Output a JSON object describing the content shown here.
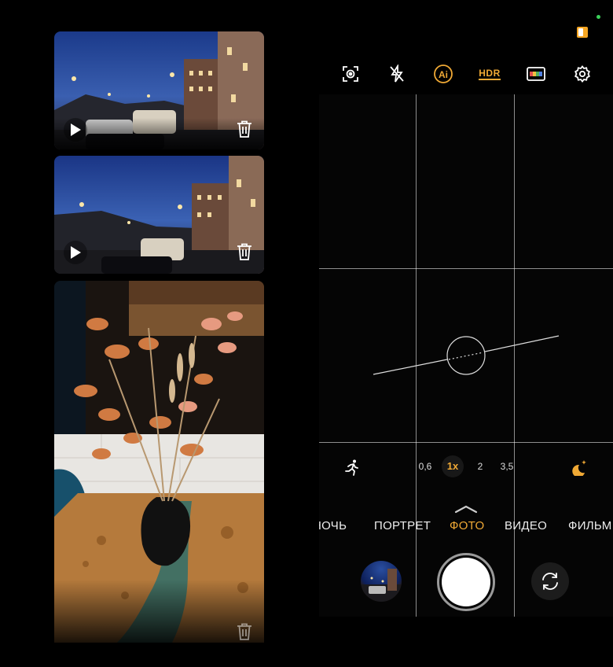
{
  "gallery": {
    "items": [
      {
        "type": "video",
        "play_icon": "play-icon",
        "delete_icon": "trash-icon"
      },
      {
        "type": "video",
        "play_icon": "play-icon",
        "delete_icon": "trash-icon"
      },
      {
        "type": "photo",
        "delete_icon": "trash-icon"
      }
    ]
  },
  "status": {
    "indicator_color": "#3bd15a",
    "badge_color": "#f5a623"
  },
  "toolbar": {
    "icons": [
      "lens-scan-icon",
      "flash-off-icon",
      "ai-icon",
      "hdr-icon",
      "filter-icon",
      "settings-icon"
    ],
    "hdr_label": "HDR",
    "ai_label": "Ai"
  },
  "zoom": {
    "levels": [
      "0,6",
      "1x",
      "2",
      "3,5"
    ],
    "selected": "1x"
  },
  "modes": {
    "items": [
      "НОЧЬ",
      "ПОРТРЕТ",
      "ФОТО",
      "ВИДЕО",
      "ФИЛЬМ"
    ],
    "selected": "ФОТО"
  },
  "colors": {
    "accent": "#f0a935",
    "background": "#000000"
  }
}
